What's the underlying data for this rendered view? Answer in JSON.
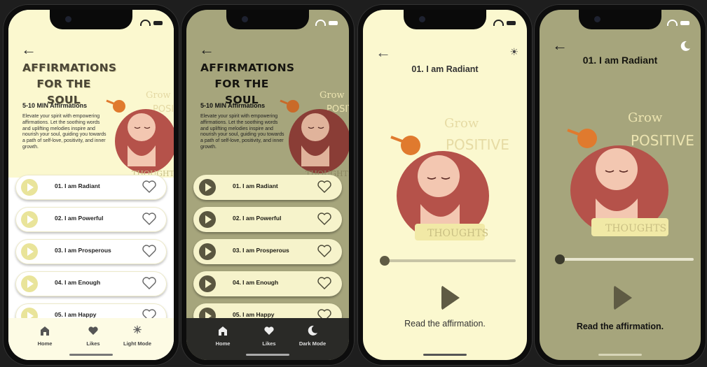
{
  "phone1": {
    "title_line1": "AFFIRMATIONS",
    "title_line2": "FOR THE SOUL",
    "subtitle": "5-10 MIN Affirmations",
    "description": "Elevate your spirit with empowering affirmations. Let the soothing words and uplifting melodies inspire and nourish your soul, guiding you towards a path of self-love, positivity, and inner growth.",
    "art_text": {
      "grow": "Grow",
      "positive": "POSITIVE",
      "thoughts": "THOUGHTS"
    },
    "tracks": [
      "01. I am Radiant",
      "02. I am Powerful",
      "03. I am Prosperous",
      "04. I am Enough",
      "05. I am Happy"
    ],
    "tabs": {
      "home": "Home",
      "likes": "Likes",
      "mode": "Light Mode"
    }
  },
  "phone2": {
    "title_line1": "AFFIRMATIONS",
    "title_line2": "FOR THE SOUL",
    "subtitle": "5-10 MIN Affirmations",
    "description": "Elevate your spirit with empowering affirmations. Let the soothing words and uplifting melodies inspire and nourish your soul, guiding you towards a path of self-love, positivity, and inner growth.",
    "art_text": {
      "grow": "Grow",
      "positive": "POSITIVE",
      "thoughts": "THOUGHTS"
    },
    "tracks": [
      "01. I am Radiant",
      "02. I am Powerful",
      "03. I am Prosperous",
      "04. I am Enough",
      "05. I am Happy"
    ],
    "tabs": {
      "home": "Home",
      "likes": "Likes",
      "mode": "Dark Mode"
    }
  },
  "phone3": {
    "title": "01. I am Radiant",
    "caption": "Read the affirmation.",
    "art_text": {
      "grow": "Grow",
      "positive": "POSITIVE",
      "thoughts": "THOUGHTS"
    },
    "progress": 0
  },
  "phone4": {
    "title": "01. I am Radiant",
    "caption": "Read the affirmation.",
    "art_text": {
      "grow": "Grow",
      "positive": "POSITIVE",
      "thoughts": "THOUGHTS"
    },
    "progress": 0
  },
  "colors": {
    "light_bg": "#fbf8cf",
    "dark_bg": "#a6a57c",
    "olive": "#5f5b44",
    "dark_bar": "#2a2a27",
    "hair": "#b5524a",
    "skin": "#f3c7b1"
  }
}
